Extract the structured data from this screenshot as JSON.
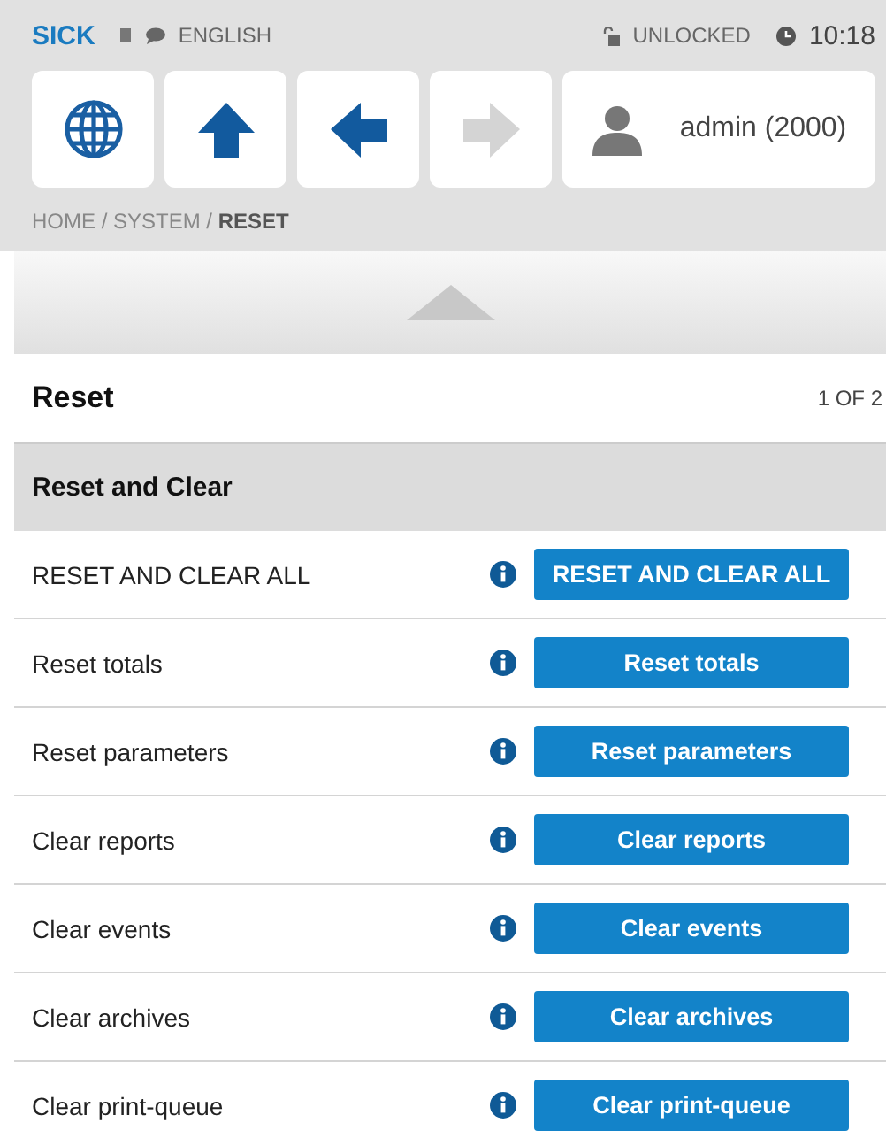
{
  "top_bar": {
    "logo": "SICK",
    "language": "ENGLISH",
    "lock_status": "UNLOCKED",
    "time": "10:18"
  },
  "nav_buttons": [
    {
      "kind": "globe",
      "disabled": false
    },
    {
      "kind": "up",
      "disabled": false
    },
    {
      "kind": "back",
      "disabled": false
    },
    {
      "kind": "forward",
      "disabled": true
    }
  ],
  "user": {
    "label": "admin (2000)"
  },
  "breadcrumb": "HOME / SYSTEM / **RESET**",
  "page": {
    "title": "Reset",
    "pager": "1 OF 2"
  },
  "section": {
    "title": "Reset and Clear"
  },
  "rows": [
    {
      "label": "RESET AND CLEAR ALL",
      "button": "RESET AND CLEAR ALL"
    },
    {
      "label": "Reset totals",
      "button": "Reset totals"
    },
    {
      "label": "Reset parameters",
      "button": "Reset parameters"
    },
    {
      "label": "Clear reports",
      "button": "Clear reports"
    },
    {
      "label": "Clear events",
      "button": "Clear events"
    },
    {
      "label": "Clear archives",
      "button": "Clear archives"
    },
    {
      "label": "Clear print-queue",
      "button": "Clear print-queue"
    }
  ]
}
